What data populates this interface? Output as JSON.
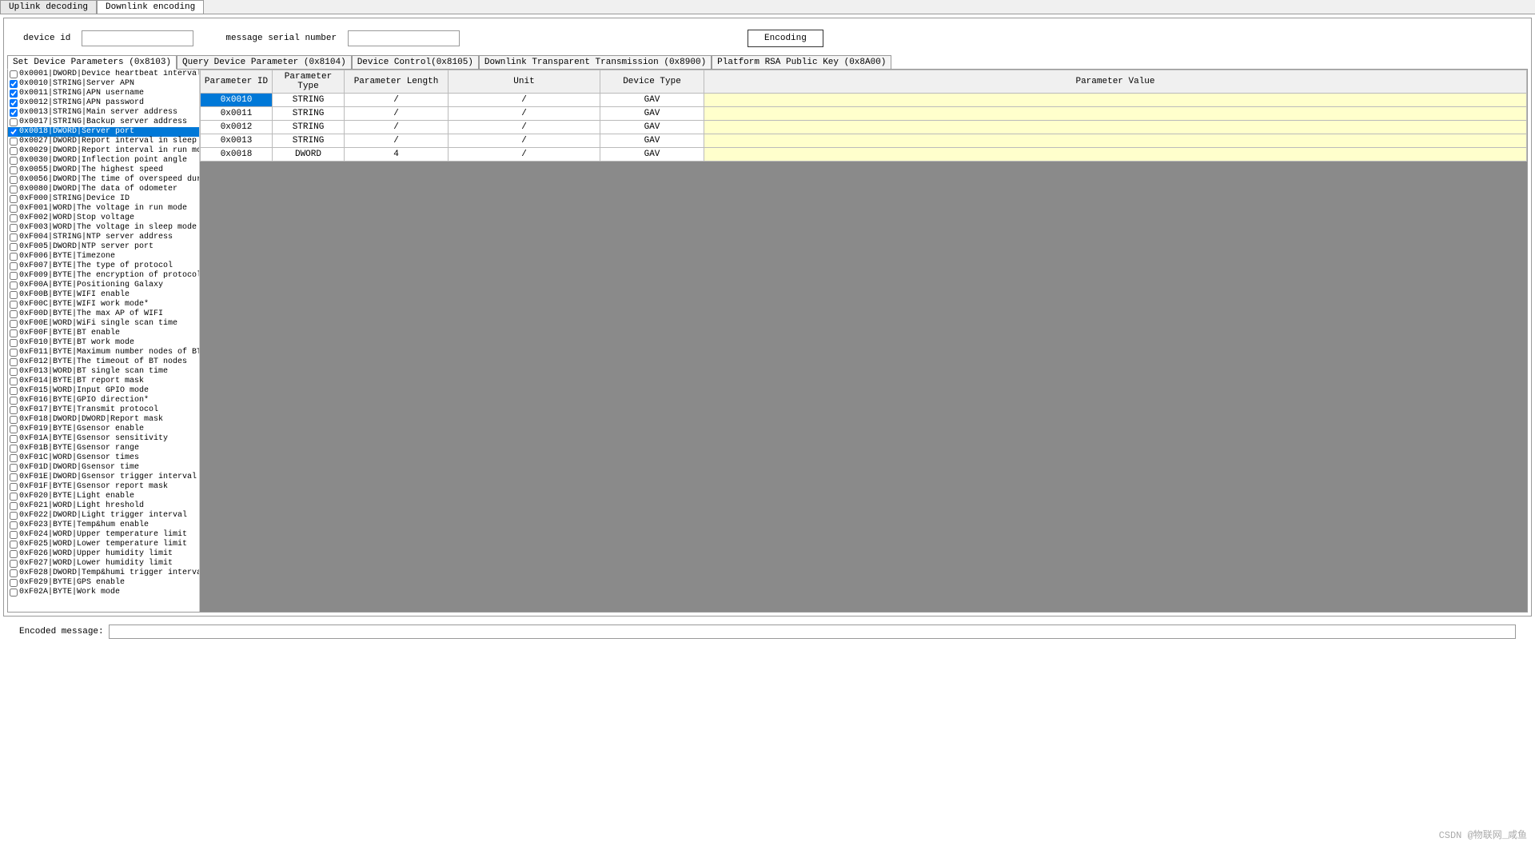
{
  "main_tabs": [
    "Uplink decoding",
    "Downlink encoding"
  ],
  "active_main_tab": 1,
  "form": {
    "device_id_label": "device id",
    "device_id_value": "",
    "serial_label": "message serial number",
    "serial_value": "",
    "encode_btn": "Encoding"
  },
  "inner_tabs": [
    "Set Device Parameters (0x8103)",
    "Query Device Parameter (0x8104)",
    "Device Control(0x8105)",
    "Downlink Transparent Transmission (0x8900)",
    "Platform RSA Public Key (0x8A00)"
  ],
  "active_inner_tab": 0,
  "param_list": [
    {
      "id": "0x0001",
      "type": "DWORD",
      "name": "Device heartbeat interval",
      "checked": false
    },
    {
      "id": "0x0010",
      "type": "STRING",
      "name": "Server APN",
      "checked": true
    },
    {
      "id": "0x0011",
      "type": "STRING",
      "name": "APN username",
      "checked": true
    },
    {
      "id": "0x0012",
      "type": "STRING",
      "name": "APN password",
      "checked": true
    },
    {
      "id": "0x0013",
      "type": "STRING",
      "name": "Main server address",
      "checked": true
    },
    {
      "id": "0x0017",
      "type": "STRING",
      "name": "Backup server address",
      "checked": false
    },
    {
      "id": "0x0018",
      "type": "DWORD",
      "name": "Server port",
      "checked": true,
      "selected": true
    },
    {
      "id": "0x0027",
      "type": "DWORD",
      "name": "Report interval in sleep  mode",
      "checked": false
    },
    {
      "id": "0x0029",
      "type": "DWORD",
      "name": "Report interval in run mode",
      "checked": false
    },
    {
      "id": "0x0030",
      "type": "DWORD",
      "name": "Inflection point angle",
      "checked": false
    },
    {
      "id": "0x0055",
      "type": "DWORD",
      "name": "The highest speed",
      "checked": false
    },
    {
      "id": "0x0056",
      "type": "DWORD",
      "name": "The time  of overspeed duration",
      "checked": false
    },
    {
      "id": "0x0080",
      "type": "DWORD",
      "name": "The data of odometer",
      "checked": false
    },
    {
      "id": "0xF000",
      "type": "STRING",
      "name": "Device ID",
      "checked": false
    },
    {
      "id": "0xF001",
      "type": "WORD",
      "name": "The voltage in run mode",
      "checked": false
    },
    {
      "id": "0xF002",
      "type": "WORD",
      "name": "Stop voltage",
      "checked": false
    },
    {
      "id": "0xF003",
      "type": "WORD",
      "name": "The voltage in sleep mode",
      "checked": false
    },
    {
      "id": "0xF004",
      "type": "STRING",
      "name": "NTP server address",
      "checked": false
    },
    {
      "id": "0xF005",
      "type": "DWORD",
      "name": "NTP server port",
      "checked": false
    },
    {
      "id": "0xF006",
      "type": "BYTE",
      "name": "Timezone",
      "checked": false
    },
    {
      "id": "0xF007",
      "type": "BYTE",
      "name": "The type of protocol",
      "checked": false
    },
    {
      "id": "0xF009",
      "type": "BYTE",
      "name": "The encryption of protocol",
      "checked": false
    },
    {
      "id": "0xF00A",
      "type": "BYTE",
      "name": "Positioning Galaxy",
      "checked": false
    },
    {
      "id": "0xF00B",
      "type": "BYTE",
      "name": "WIFI enable",
      "checked": false
    },
    {
      "id": "0xF00C",
      "type": "BYTE",
      "name": "WIFI work mode*",
      "checked": false
    },
    {
      "id": "0xF00D",
      "type": "BYTE",
      "name": "The max AP of WIFI",
      "checked": false
    },
    {
      "id": "0xF00E",
      "type": "WORD",
      "name": "WiFi single scan time",
      "checked": false
    },
    {
      "id": "0xF00F",
      "type": "BYTE",
      "name": "BT enable",
      "checked": false
    },
    {
      "id": "0xF010",
      "type": "BYTE",
      "name": "BT work mode",
      "checked": false
    },
    {
      "id": "0xF011",
      "type": "BYTE",
      "name": "Maximum number nodes of BT",
      "checked": false
    },
    {
      "id": "0xF012",
      "type": "BYTE",
      "name": "The timeout of BT nodes",
      "checked": false
    },
    {
      "id": "0xF013",
      "type": "WORD",
      "name": "BT single scan time",
      "checked": false
    },
    {
      "id": "0xF014",
      "type": "BYTE",
      "name": "BT report mask",
      "checked": false
    },
    {
      "id": "0xF015",
      "type": "WORD",
      "name": "Input GPIO mode",
      "checked": false
    },
    {
      "id": "0xF016",
      "type": "BYTE",
      "name": "GPIO direction*",
      "checked": false
    },
    {
      "id": "0xF017",
      "type": "BYTE",
      "name": "Transmit protocol",
      "checked": false
    },
    {
      "id": "0xF018",
      "type": "DWORD|DWORD",
      "name": "Report mask",
      "checked": false
    },
    {
      "id": "0xF019",
      "type": "BYTE",
      "name": "Gsensor enable",
      "checked": false
    },
    {
      "id": "0xF01A",
      "type": "BYTE",
      "name": "Gsensor sensitivity",
      "checked": false
    },
    {
      "id": "0xF01B",
      "type": "BYTE",
      "name": "Gsensor range",
      "checked": false
    },
    {
      "id": "0xF01C",
      "type": "WORD",
      "name": "Gsensor times",
      "checked": false
    },
    {
      "id": "0xF01D",
      "type": "DWORD",
      "name": "Gsensor time",
      "checked": false
    },
    {
      "id": "0xF01E",
      "type": "DWORD",
      "name": "Gsensor trigger interval",
      "checked": false
    },
    {
      "id": "0xF01F",
      "type": "BYTE",
      "name": "Gsensor report mask",
      "checked": false
    },
    {
      "id": "0xF020",
      "type": "BYTE",
      "name": "Light enable",
      "checked": false
    },
    {
      "id": "0xF021",
      "type": "WORD",
      "name": "Light hreshold",
      "checked": false
    },
    {
      "id": "0xF022",
      "type": "DWORD",
      "name": "Light trigger interval",
      "checked": false
    },
    {
      "id": "0xF023",
      "type": "BYTE",
      "name": "Temp&hum enable",
      "checked": false
    },
    {
      "id": "0xF024",
      "type": "WORD",
      "name": "Upper temperature limit",
      "checked": false
    },
    {
      "id": "0xF025",
      "type": "WORD",
      "name": "Lower temperature limit",
      "checked": false
    },
    {
      "id": "0xF026",
      "type": "WORD",
      "name": "Upper humidity limit",
      "checked": false
    },
    {
      "id": "0xF027",
      "type": "WORD",
      "name": "Lower humidity limit",
      "checked": false
    },
    {
      "id": "0xF028",
      "type": "DWORD",
      "name": "Temp&humi trigger interval",
      "checked": false
    },
    {
      "id": "0xF029",
      "type": "BYTE",
      "name": "GPS enable",
      "checked": false
    },
    {
      "id": "0xF02A",
      "type": "BYTE",
      "name": "Work mode",
      "checked": false
    }
  ],
  "table": {
    "headers": [
      "Parameter ID",
      "Parameter Type",
      "Parameter Length",
      "Unit",
      "Device Type",
      "Parameter Value"
    ],
    "rows": [
      {
        "id": "0x0010",
        "type": "STRING",
        "len": "/",
        "unit": "/",
        "dev": "GAV",
        "val": "",
        "selected": true
      },
      {
        "id": "0x0011",
        "type": "STRING",
        "len": "/",
        "unit": "/",
        "dev": "GAV",
        "val": ""
      },
      {
        "id": "0x0012",
        "type": "STRING",
        "len": "/",
        "unit": "/",
        "dev": "GAV",
        "val": ""
      },
      {
        "id": "0x0013",
        "type": "STRING",
        "len": "/",
        "unit": "/",
        "dev": "GAV",
        "val": ""
      },
      {
        "id": "0x0018",
        "type": "DWORD",
        "len": "4",
        "unit": "/",
        "dev": "GAV",
        "val": ""
      }
    ]
  },
  "bottom": {
    "label": "Encoded message:",
    "value": ""
  },
  "watermark": "CSDN @物联网_咸鱼"
}
